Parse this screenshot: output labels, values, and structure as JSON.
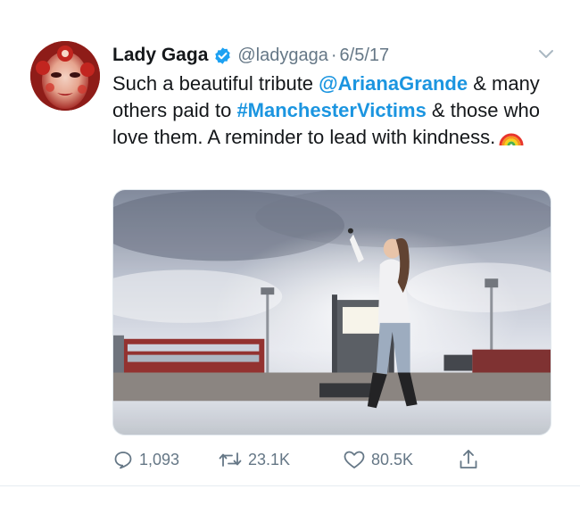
{
  "tweet": {
    "display_name": "Lady Gaga",
    "handle": "@ladygaga",
    "separator": "·",
    "date": "6/5/17",
    "text": {
      "part1": "Such a beautiful tribute ",
      "mention": "@ArianaGrande",
      "part2": "  & many others paid to ",
      "hashtag": "#ManchesterVictims",
      "part3": " & those who love them. A reminder to lead with kindness."
    },
    "emoji": "rainbow-icon",
    "media_alt": "photo"
  },
  "actions": {
    "replies": "1,093",
    "retweets": "23.1K",
    "likes": "80.5K"
  },
  "icons": {
    "verified": "verified-badge-icon",
    "caret": "chevron-down-icon",
    "reply": "reply-icon",
    "retweet": "retweet-icon",
    "like": "heart-icon",
    "share": "share-icon"
  },
  "colors": {
    "link": "#1b95e0",
    "text": "#14171a",
    "muted": "#657786",
    "verified": "#1da1f2"
  }
}
